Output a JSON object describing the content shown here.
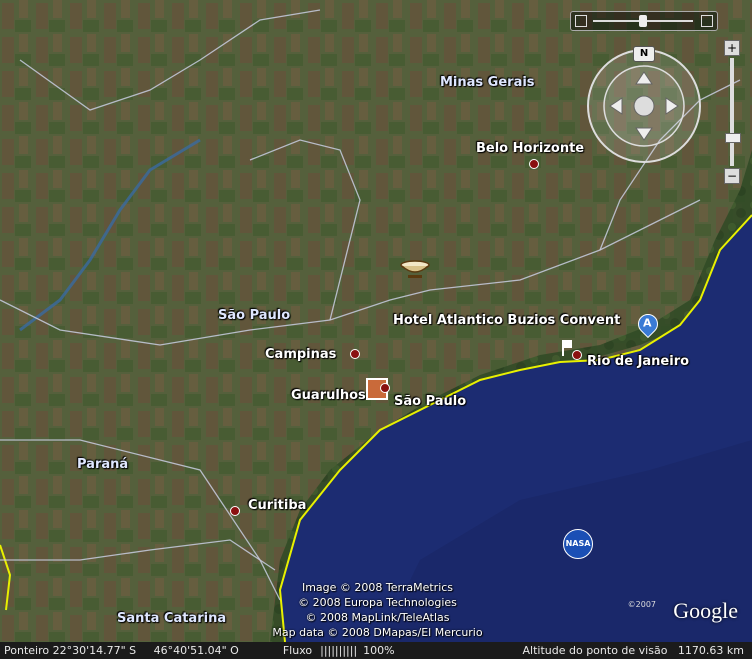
{
  "map": {
    "states": [
      "Minas Gerais",
      "São Paulo",
      "Paraná",
      "Santa Catarina"
    ],
    "cities": [
      "Belo Horizonte",
      "Campinas",
      "Guarulhos",
      "São Paulo",
      "Rio de Janeiro",
      "Curitiba"
    ],
    "poi": {
      "hotel": "Hotel Atlantico Buzios Convent",
      "marker_letter": "A",
      "nasa": "NASA"
    },
    "colors": {
      "ocean": "#1a2a6e",
      "coast": "#e8f000",
      "land": "#5b6640",
      "border": "#c8cce0"
    }
  },
  "navigation": {
    "compass_label": "N",
    "zoom_in": "+",
    "zoom_out": "−"
  },
  "attribution": [
    "Image © 2008 TerraMetrics",
    "© 2008 Europa Technologies",
    "© 2008 MapLink/TeleAtlas",
    "Map data © 2008 DMapas/El Mercurio"
  ],
  "logo": {
    "year": "©2007",
    "name": "Google"
  },
  "status_bar": {
    "pointer": "Ponteiro 22°30'14.77\" S     46°40'51.04\" O",
    "stream_label": "Fluxo",
    "stream_bars": "||||||||||",
    "stream_pct": "100%",
    "altitude": "Altitude do ponto de visão   1170.63 km"
  }
}
